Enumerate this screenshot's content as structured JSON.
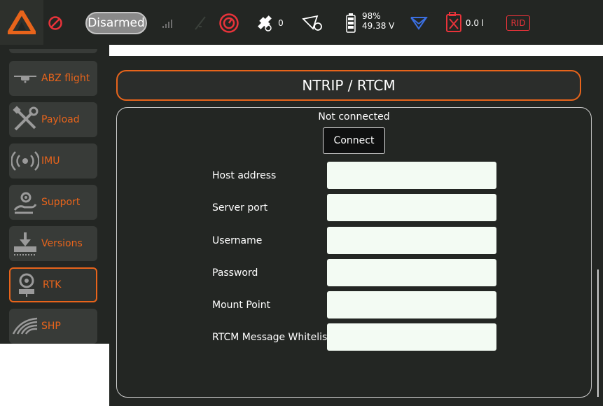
{
  "topbar": {
    "status": "Disarmed",
    "satellites": "0",
    "battery_percent": "98%",
    "battery_voltage": "49.38 V",
    "tank_level": "0.0 l",
    "rid_label": "RID"
  },
  "menu": [
    {
      "label": "ABZ flight",
      "icon": "drone-icon"
    },
    {
      "label": "Payload",
      "icon": "tools-icon"
    },
    {
      "label": "IMU",
      "icon": "signal-waves-icon"
    },
    {
      "label": "Support",
      "icon": "support-hand-gear-icon"
    },
    {
      "label": "Versions",
      "icon": "download-tray-icon"
    },
    {
      "label": "RTK",
      "icon": "rtk-station-icon",
      "active": true
    },
    {
      "label": "SHP",
      "icon": "field-rows-icon"
    }
  ],
  "page": {
    "title": "NTRIP / RTCM",
    "connection_status": "Not connected",
    "connect_label": "Connect"
  },
  "form": [
    {
      "label": "Host address",
      "value": ""
    },
    {
      "label": "Server port",
      "value": ""
    },
    {
      "label": "Username",
      "value": ""
    },
    {
      "label": "Password",
      "value": ""
    },
    {
      "label": "Mount Point",
      "value": ""
    },
    {
      "label": "RTCM Message Whitelist",
      "value": ""
    }
  ],
  "colors": {
    "accent": "#e8641b",
    "background": "#232623",
    "input_bg": "#f3fbf3",
    "alert_red": "#e8333a",
    "nav_blue": "#3b6fe0"
  }
}
